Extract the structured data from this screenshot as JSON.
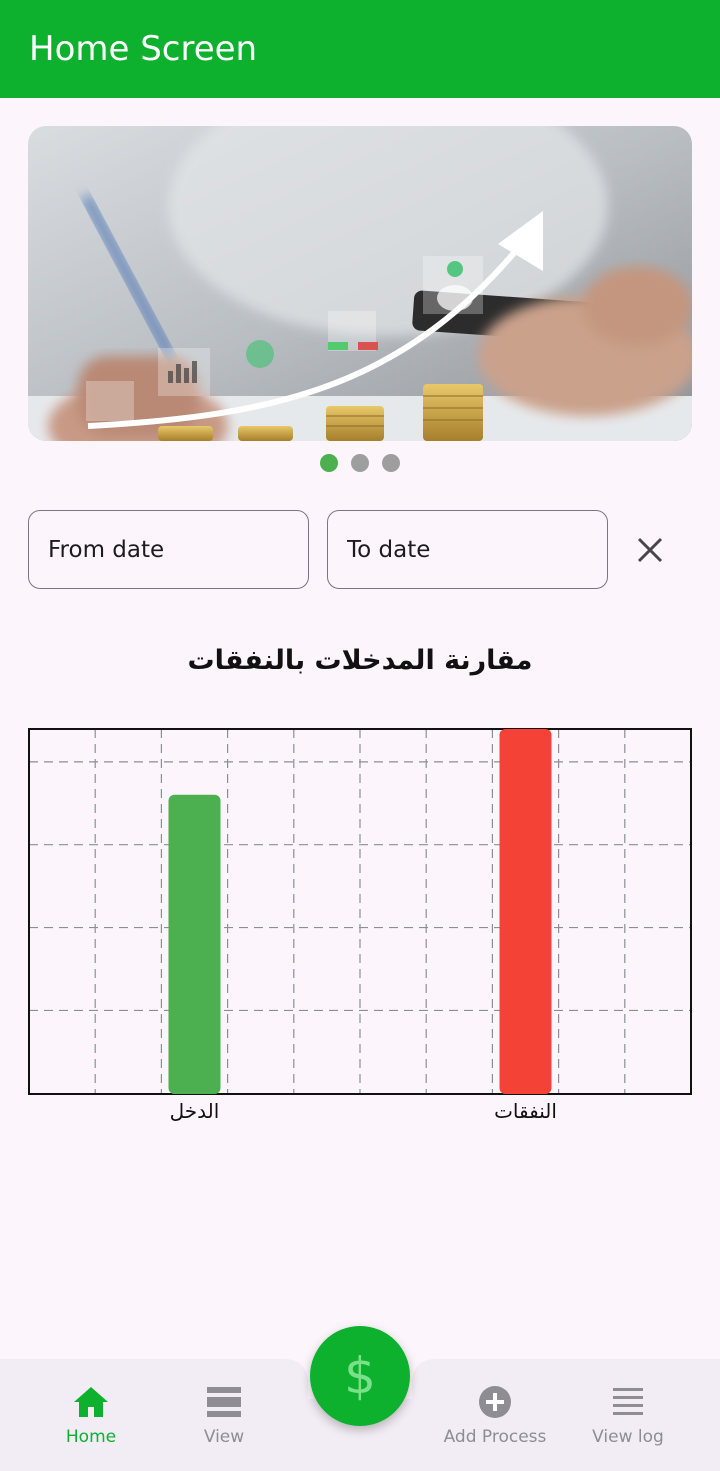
{
  "appbar": {
    "title": "Home Screen"
  },
  "carousel": {
    "active_index": 0,
    "page_count": 3,
    "accent": "#4caf50",
    "inactive": "#9e9e9e"
  },
  "filters": {
    "from_placeholder": "From date",
    "to_placeholder": "To date",
    "clear_icon": "close-icon"
  },
  "chart_data": {
    "type": "bar",
    "title": "مقارنة المدخلات بالنفقات",
    "categories": [
      "الدخل",
      "النفقات"
    ],
    "values": [
      82,
      100
    ],
    "colors": [
      "#4caf50",
      "#f44336"
    ],
    "ylim": [
      0,
      100
    ],
    "grid": true
  },
  "bottom_nav": {
    "items": [
      {
        "label": "Home",
        "icon": "home-icon",
        "active": true
      },
      {
        "label": "View",
        "icon": "view-list-icon",
        "active": false
      },
      {
        "label": "Add Process",
        "icon": "add-circle-icon",
        "active": false
      },
      {
        "label": "View log",
        "icon": "log-list-icon",
        "active": false
      }
    ],
    "fab_symbol": "$",
    "active_color": "#0db12e",
    "inactive_color": "#8d8d93"
  }
}
